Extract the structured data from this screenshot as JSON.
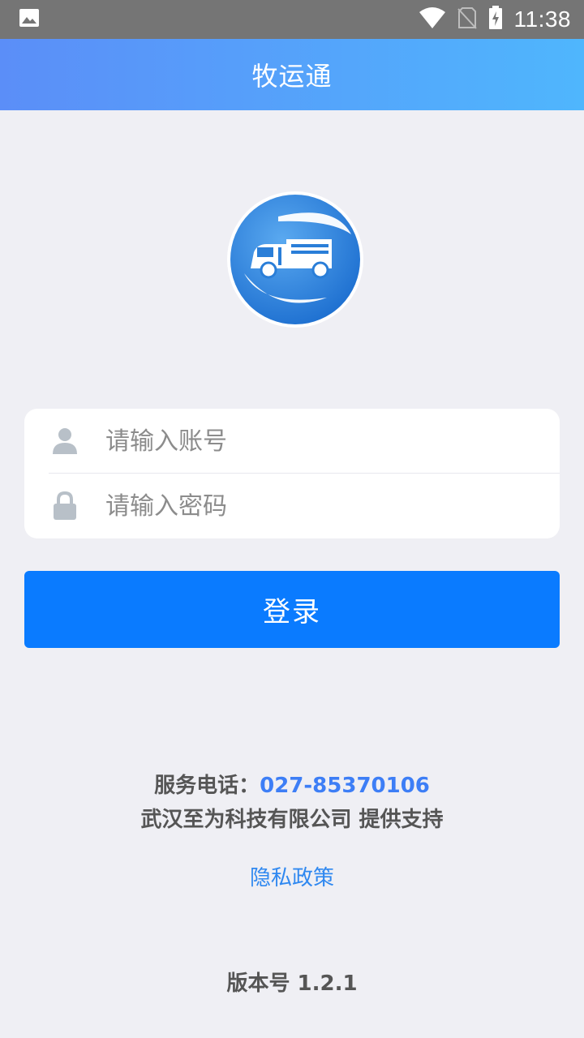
{
  "status_bar": {
    "time": "11:38",
    "icons": [
      "image-icon",
      "wifi-icon",
      "no-sim-icon",
      "battery-charging-icon"
    ]
  },
  "app_bar": {
    "title": "牧运通"
  },
  "login": {
    "account_placeholder": "请输入账号",
    "password_placeholder": "请输入密码",
    "account_icon": "user-icon",
    "password_icon": "lock-icon",
    "submit_label": "登录"
  },
  "footer": {
    "service_label": "服务电话：",
    "service_phone": "027-85370106",
    "support_text": "武汉至为科技有限公司 提供支持",
    "privacy_label": "隐私政策",
    "version_text": "版本号 1.2.1"
  },
  "colors": {
    "accent": "#0a7bff",
    "app_bar_start": "#5b8ef8",
    "app_bar_end": "#4fb6fd",
    "link": "#2f88f0",
    "background": "#efeff4"
  }
}
